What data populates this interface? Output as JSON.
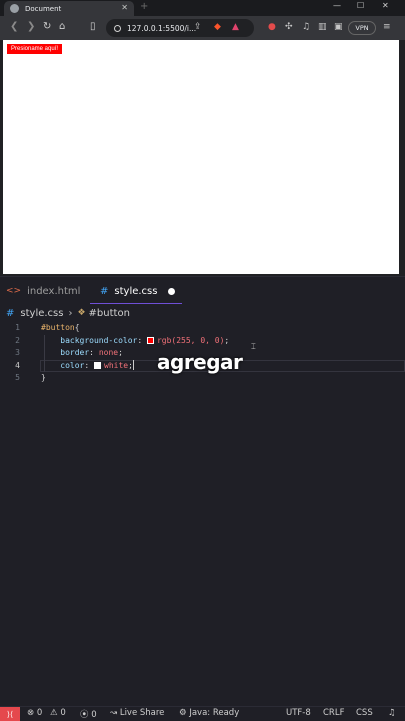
{
  "browser": {
    "tab_title": "Document",
    "tab_close": "✕",
    "new_tab": "+",
    "url": "127.0.0.1:5500/i...",
    "vpn_label": "VPN",
    "window": {
      "minimize": "—",
      "maximize": "☐",
      "close": "✕"
    },
    "page_button_label": "Presioname aquí!"
  },
  "editor": {
    "tabs": [
      {
        "label": "index.html",
        "icon": "html-icon"
      },
      {
        "label": "style.css",
        "icon": "css-icon",
        "active": true,
        "unsaved": true
      }
    ],
    "breadcrumb": {
      "file": "style.css",
      "symbol": "#button"
    },
    "lines": [
      {
        "num": "1",
        "selector": "#button",
        "brace": "{"
      },
      {
        "num": "2",
        "prop": "background-color",
        "value": "rgb(255, 0, 0)",
        "swatch": "#ff0000"
      },
      {
        "num": "3",
        "prop": "border",
        "value": "none"
      },
      {
        "num": "4",
        "prop": "color",
        "value": "white",
        "swatch": "#ffffff"
      },
      {
        "num": "5",
        "brace": "}"
      }
    ],
    "overlay_word": "agregar"
  },
  "statusbar": {
    "remote": "⟩⟨",
    "errors": "0",
    "warnings": "0",
    "ports": "0",
    "live_share": "Live Share",
    "java": "Java: Ready",
    "encoding": "UTF-8",
    "eol": "CRLF",
    "language": "CSS"
  }
}
